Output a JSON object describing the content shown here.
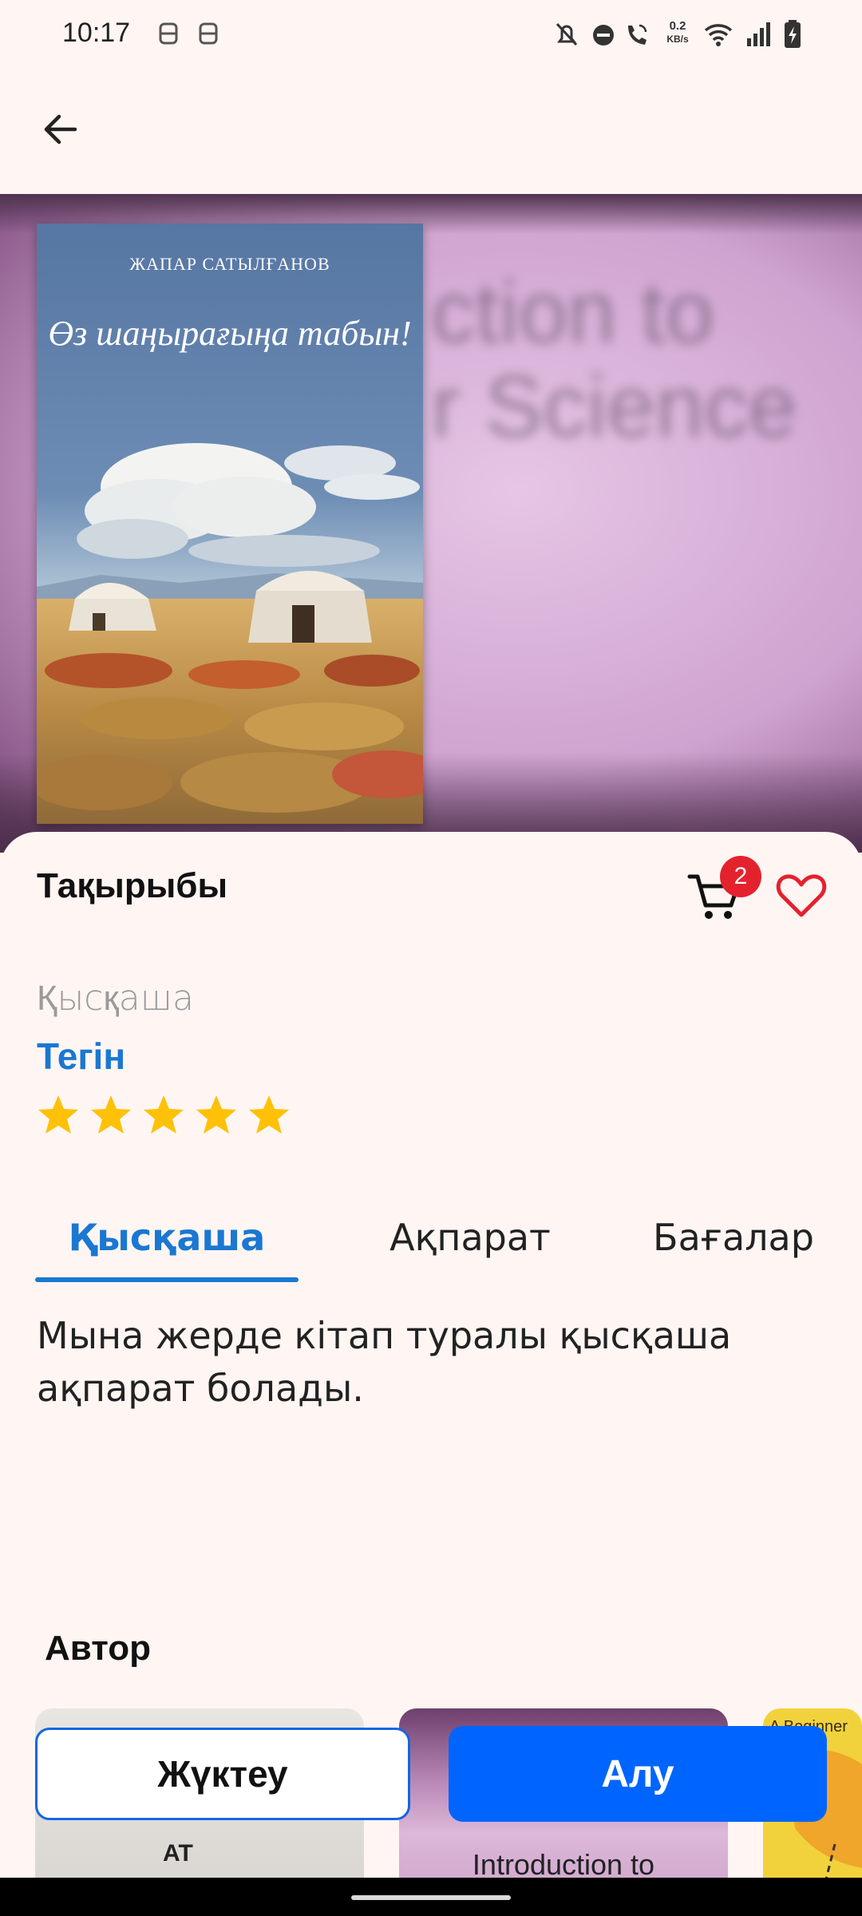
{
  "status_bar": {
    "time": "10:17",
    "net_speed_value": "0.2",
    "net_speed_unit": "KB/s",
    "icons": [
      "notification-app-icon",
      "notification-app-icon",
      "bell-off-icon",
      "dnd-icon",
      "call-wifi-icon",
      "wifi-icon",
      "signal-icon",
      "battery-charging-icon"
    ]
  },
  "app_bar": {
    "back_icon": "arrow-left-icon"
  },
  "hero": {
    "blurred_background_text": "ction to\nr Science",
    "cover": {
      "author": "ЖАПАР САТЫЛҒАНОВ",
      "title": "Өз шаңырағыңа табын!"
    }
  },
  "book": {
    "title": "Тақырыбы",
    "subtitle": "Қысқаша",
    "price": "Тегін",
    "rating": 5,
    "rating_max": 5,
    "cart_count": "2"
  },
  "tabs": {
    "items": [
      "Қысқаша",
      "Ақпарат",
      "Бағалар"
    ],
    "active": 0
  },
  "description": "Мына жерде кітап туралы қысқаша ақпарат болады.",
  "author_section": {
    "heading": "Автор",
    "books": [
      {
        "visible_text": "AT"
      },
      {
        "visible_text": "Introduction to"
      },
      {
        "visible_text": "A Beginner\nomics"
      }
    ]
  },
  "actions": {
    "download_label": "Жүктеу",
    "buy_label": "Алу"
  },
  "colors": {
    "accent": "#1a77d2",
    "buy_button": "#0065ff",
    "badge": "#e4222e",
    "star": "#ffc107",
    "heart": "#e4222e",
    "background": "#fff6f3"
  }
}
